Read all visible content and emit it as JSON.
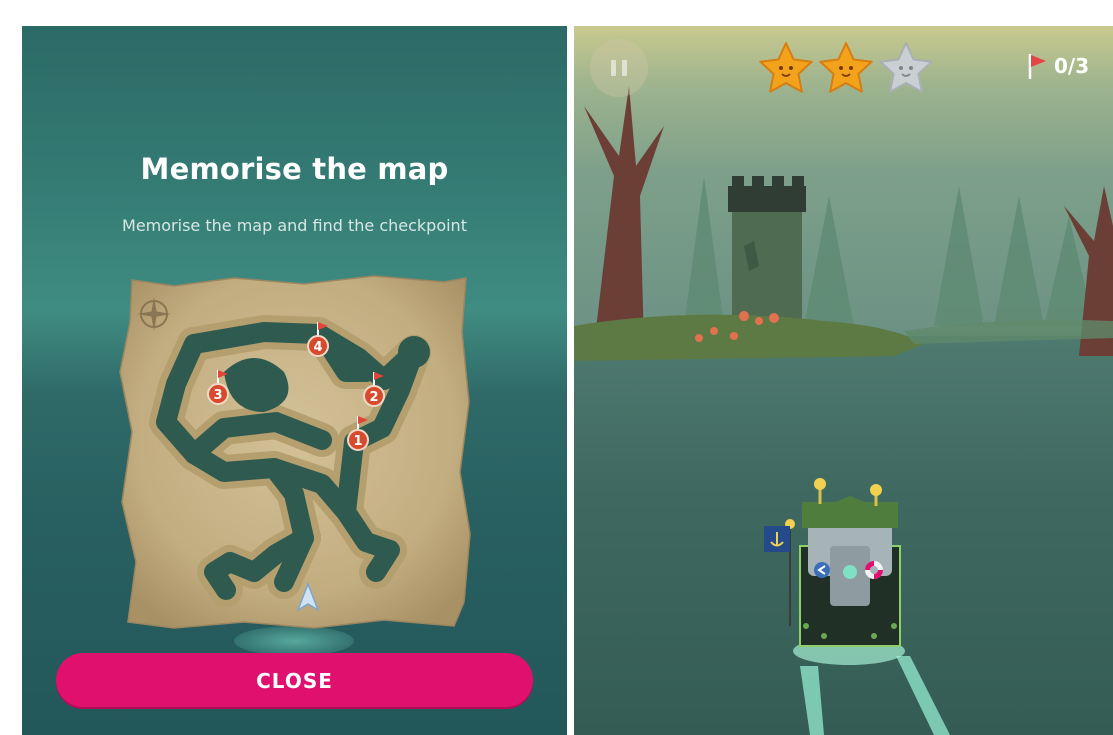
{
  "map_screen": {
    "title": "Memorise the map",
    "subtitle": "Memorise the map and find the checkpoint",
    "close_label": "CLOSE",
    "checkpoints": [
      "1",
      "2",
      "3",
      "4"
    ]
  },
  "game_hud": {
    "stars_earned": 2,
    "stars_total": 3,
    "flag_progress": "0/3"
  },
  "colors": {
    "accent": "#e0106e",
    "star_gold": "#f3a21c",
    "star_empty": "#c9cfd3",
    "checkpoint_red": "#d84a2e",
    "map_paper": "#c9b58a"
  },
  "icons": [
    "pause-icon",
    "star-icon",
    "flag-icon",
    "compass-icon",
    "player-arrow-icon",
    "anchor-icon",
    "life-ring-icon"
  ]
}
